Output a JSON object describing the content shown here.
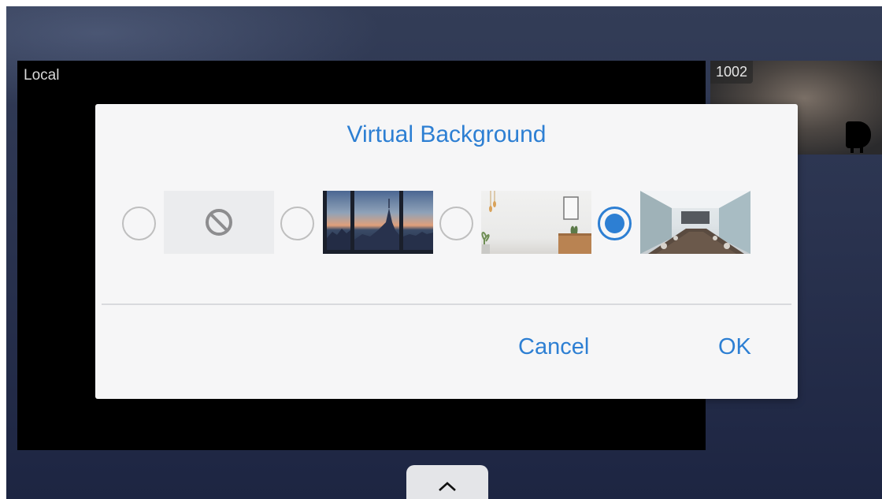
{
  "local_tile": {
    "label": "Local"
  },
  "remote_tile": {
    "label": "1002"
  },
  "dialog": {
    "title": "Virtual Background",
    "options": [
      {
        "name": "none",
        "icon": "no-background-icon",
        "selected": false
      },
      {
        "name": "city-skyline",
        "selected": false
      },
      {
        "name": "white-room",
        "selected": false
      },
      {
        "name": "conference-room",
        "selected": true
      }
    ],
    "cancel_label": "Cancel",
    "ok_label": "OK"
  },
  "toolbar_toggle": {
    "icon": "chevron-up-icon"
  },
  "colors": {
    "accent": "#2d7fd3",
    "dialog_bg": "#f6f6f7",
    "radio_border": "#bfbfbf"
  }
}
